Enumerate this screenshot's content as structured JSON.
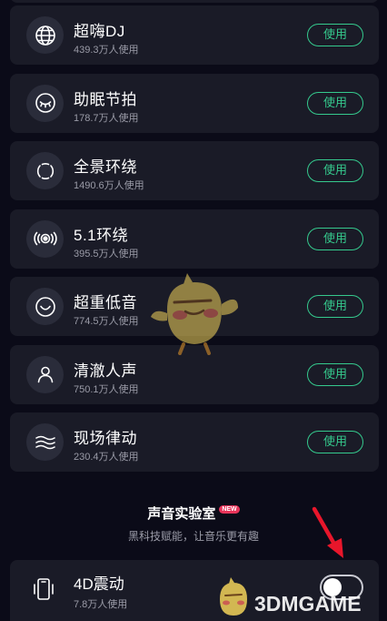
{
  "effects": [
    {
      "name": "超嗨DJ",
      "users": "439.3万人使用",
      "button": "使用",
      "icon": "globe-icon"
    },
    {
      "name": "助眠节拍",
      "users": "178.7万人使用",
      "button": "使用",
      "icon": "sleep-eye-icon"
    },
    {
      "name": "全景环绕",
      "users": "1490.6万人使用",
      "button": "使用",
      "icon": "panorama-ring-icon"
    },
    {
      "name": "5.1环绕",
      "users": "395.5万人使用",
      "button": "使用",
      "icon": "surround-speaker-icon"
    },
    {
      "name": "超重低音",
      "users": "774.5万人使用",
      "button": "使用",
      "icon": "bass-smile-icon"
    },
    {
      "name": "清澈人声",
      "users": "750.1万人使用",
      "button": "使用",
      "icon": "person-icon"
    },
    {
      "name": "现场律动",
      "users": "230.4万人使用",
      "button": "使用",
      "icon": "wave-lines-icon"
    }
  ],
  "lab": {
    "title": "声音实验室",
    "badge": "NEW",
    "subtitle": "黑科技赋能，让音乐更有趣"
  },
  "vibration": {
    "name": "4D震动",
    "users": "7.8万人使用",
    "toggle_on": false,
    "icon": "phone-vibrate-icon"
  },
  "watermark": {
    "text": "3DMGAME"
  },
  "colors": {
    "accent": "#35c98d",
    "card": "#1a1b27",
    "background": "#0b0b18",
    "arrow": "#e8162b"
  }
}
